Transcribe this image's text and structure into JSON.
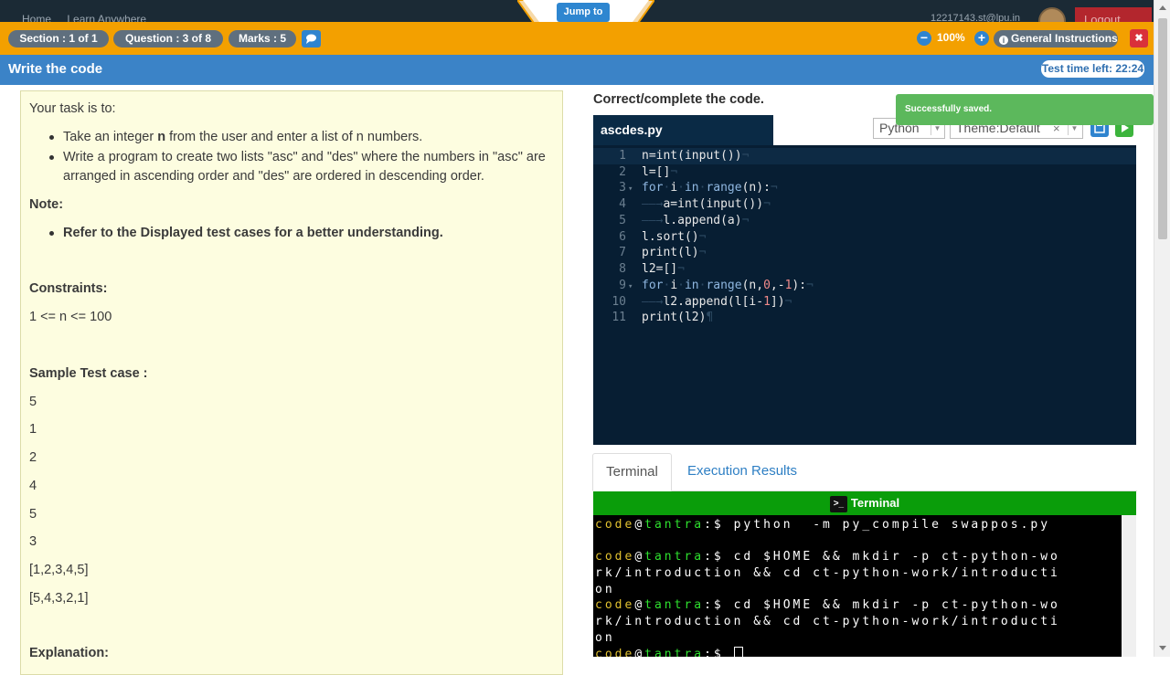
{
  "header": {
    "nav_home": "Home",
    "nav_learn": "Learn Anywhere",
    "user": "12217143.st@lpu.in",
    "logout": "Logout",
    "jump_to": "Jump to"
  },
  "statusbar": {
    "section": "Section : 1 of 1",
    "question": "Question : 3 of 8",
    "marks": "Marks : 5",
    "zoom": "100%",
    "general_instructions": "General Instructions",
    "zoom_out_icon": "minus-circle-icon",
    "zoom_in_icon": "plus-circle-icon"
  },
  "titlebar": {
    "title": "Write the code",
    "time_left": "Test time left: 22:24"
  },
  "question": {
    "intro": "Your task is to:",
    "task_1_a": "Take an integer ",
    "task_1_b": "n",
    "task_1_c": " from the user and enter a list of n numbers.",
    "task_2": "Write a program to create two lists \"asc\" and \"des\" where the numbers in \"asc\" are arranged in ascending order and \"des\" are ordered in descending order.",
    "note_label": "Note:",
    "note_1": "Refer to the Displayed test cases for a better understanding.",
    "constraints_label": "Constraints:",
    "constraints": "1 <= n <= 100",
    "sample_label": "Sample Test case :",
    "sample_lines": [
      "5",
      "1",
      "2",
      "4",
      "5",
      "3",
      "[1,2,3,4,5]",
      "[5,4,3,2,1]"
    ],
    "explanation_label": "Explanation:"
  },
  "editor": {
    "heading": "Correct/complete the code.",
    "filename": "ascdes.py",
    "language": "Python",
    "theme": "Theme:Default",
    "toast": "Successfully saved.",
    "line_numbers": [
      "1",
      "2",
      "3",
      "4",
      "5",
      "6",
      "7",
      "8",
      "9",
      "10",
      "11"
    ]
  },
  "results": {
    "tab_terminal": "Terminal",
    "tab_execution": "Execution Results",
    "terminal_title": "Terminal",
    "prompt_user": "code",
    "prompt_at": "@",
    "prompt_host": "tantra",
    "prompt_sep": ":$",
    "cmd_1": " python  -m py_compile swappos.py",
    "cmd_2a": " cd $HOME && mkdir -p ct-python-wo",
    "cmd_2b": "rk/introduction && cd ct-python-work/introducti",
    "cmd_2c": "on"
  },
  "colors": {
    "orange_bar": "#f3a000",
    "blue_bar": "#3b83c7",
    "editor_bg": "#071e33",
    "terminal_header": "#0a9d0a",
    "toast": "#5cb85c",
    "close": "#d9313a"
  }
}
